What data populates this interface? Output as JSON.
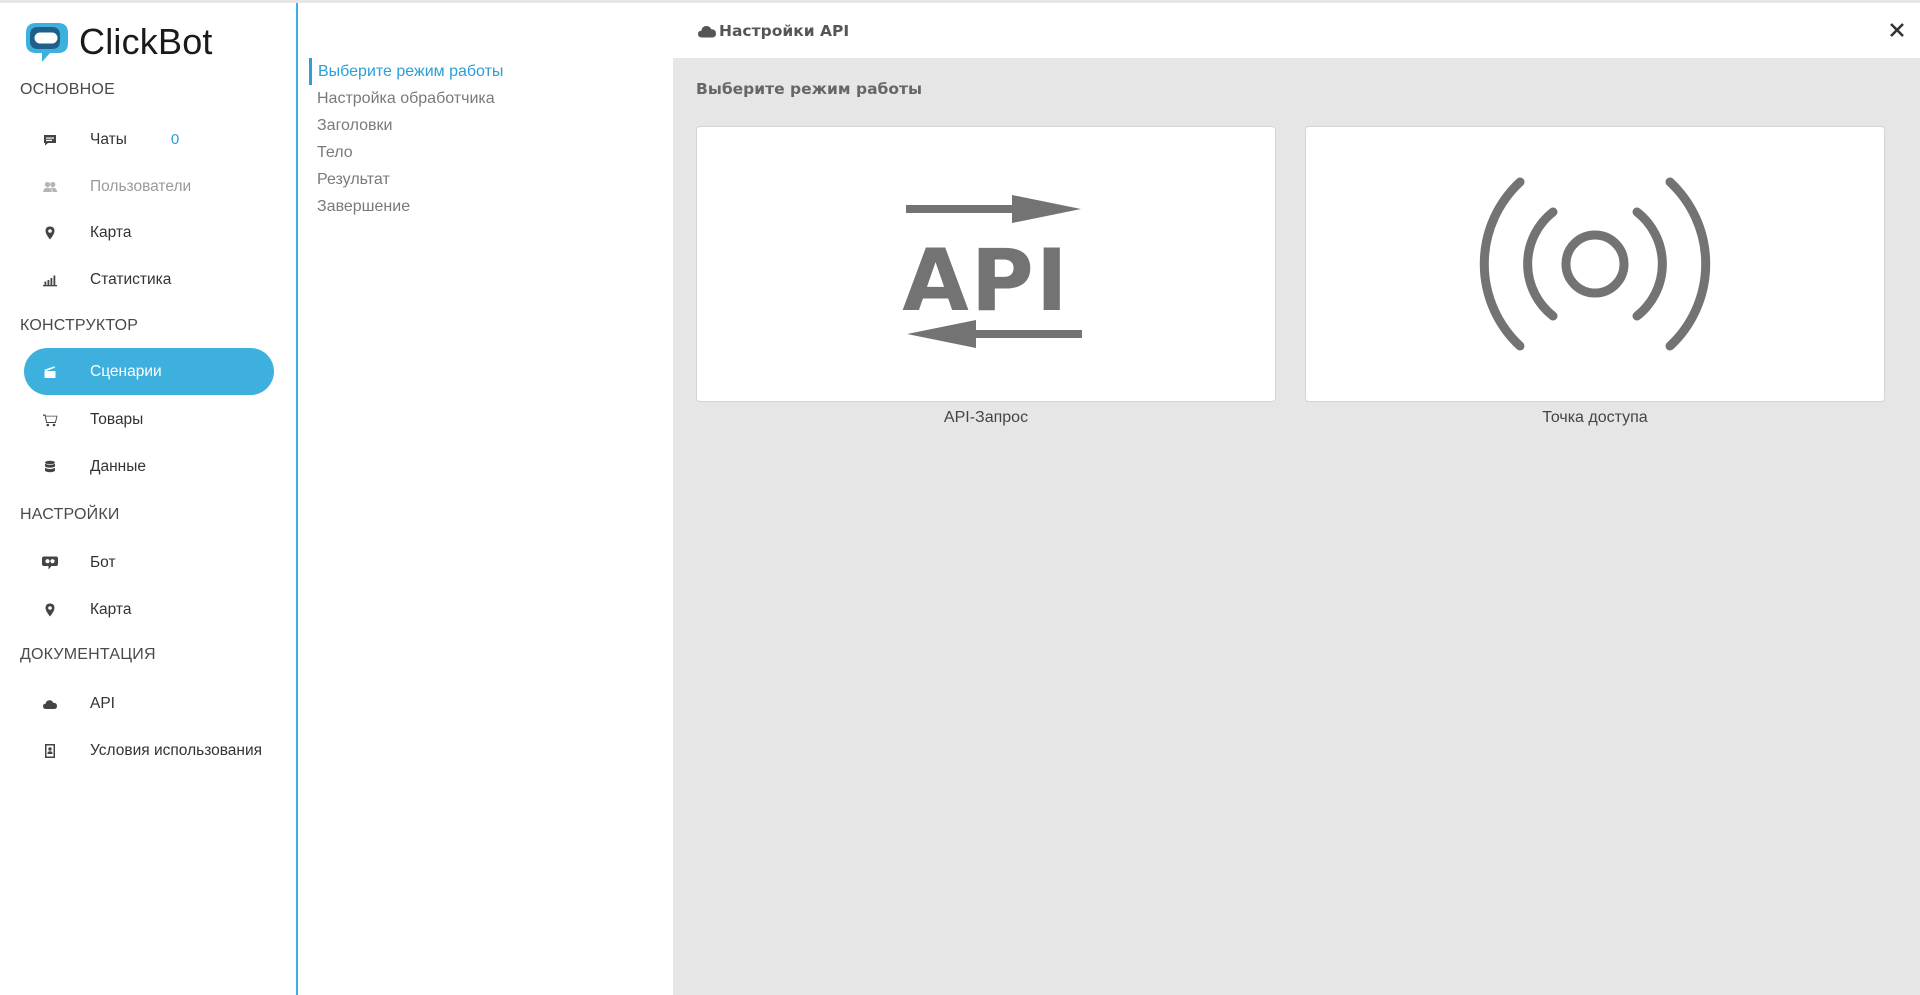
{
  "brand": {
    "name": "ClickBot"
  },
  "sidebar": {
    "sections": [
      {
        "title": "ОСНОВНОЕ"
      },
      {
        "title": "КОНСТРУКТОР"
      },
      {
        "title": "НАСТРОЙКИ"
      },
      {
        "title": "ДОКУМЕНТАЦИЯ"
      }
    ],
    "items": [
      {
        "label": "Чаты",
        "icon": "chat-icon",
        "badge": "0"
      },
      {
        "label": "Пользователи",
        "icon": "users-icon",
        "state": "disabled"
      },
      {
        "label": "Карта",
        "icon": "map-pin-icon"
      },
      {
        "label": "Статистика",
        "icon": "bar-chart-icon"
      },
      {
        "label": "Сценарии",
        "icon": "clapperboard-icon",
        "state": "active"
      },
      {
        "label": "Товары",
        "icon": "cart-icon"
      },
      {
        "label": "Данные",
        "icon": "database-icon"
      },
      {
        "label": "Бот",
        "icon": "bot-icon"
      },
      {
        "label": "Карта",
        "icon": "map-pin-icon"
      },
      {
        "label": "API",
        "icon": "cloud-icon"
      },
      {
        "label": "Условия использования",
        "icon": "document-icon"
      }
    ]
  },
  "steps": {
    "items": [
      {
        "label": "Выберите режим работы",
        "state": "active"
      },
      {
        "label": "Настройка обработчика"
      },
      {
        "label": "Заголовки"
      },
      {
        "label": "Тело"
      },
      {
        "label": "Результат"
      },
      {
        "label": "Завершение"
      }
    ]
  },
  "main": {
    "header_title": "Настройки API",
    "subtitle": "Выберите режим работы",
    "options": [
      {
        "label": "API-Запрос",
        "icon": "api-arrows-icon",
        "art_text": "API"
      },
      {
        "label": "Точка доступа",
        "icon": "broadcast-icon"
      }
    ]
  },
  "colors": {
    "accent": "#3db0de",
    "link": "#2a9fd8",
    "main_bg": "#e6e6e6",
    "icon_gray": "#737373"
  }
}
